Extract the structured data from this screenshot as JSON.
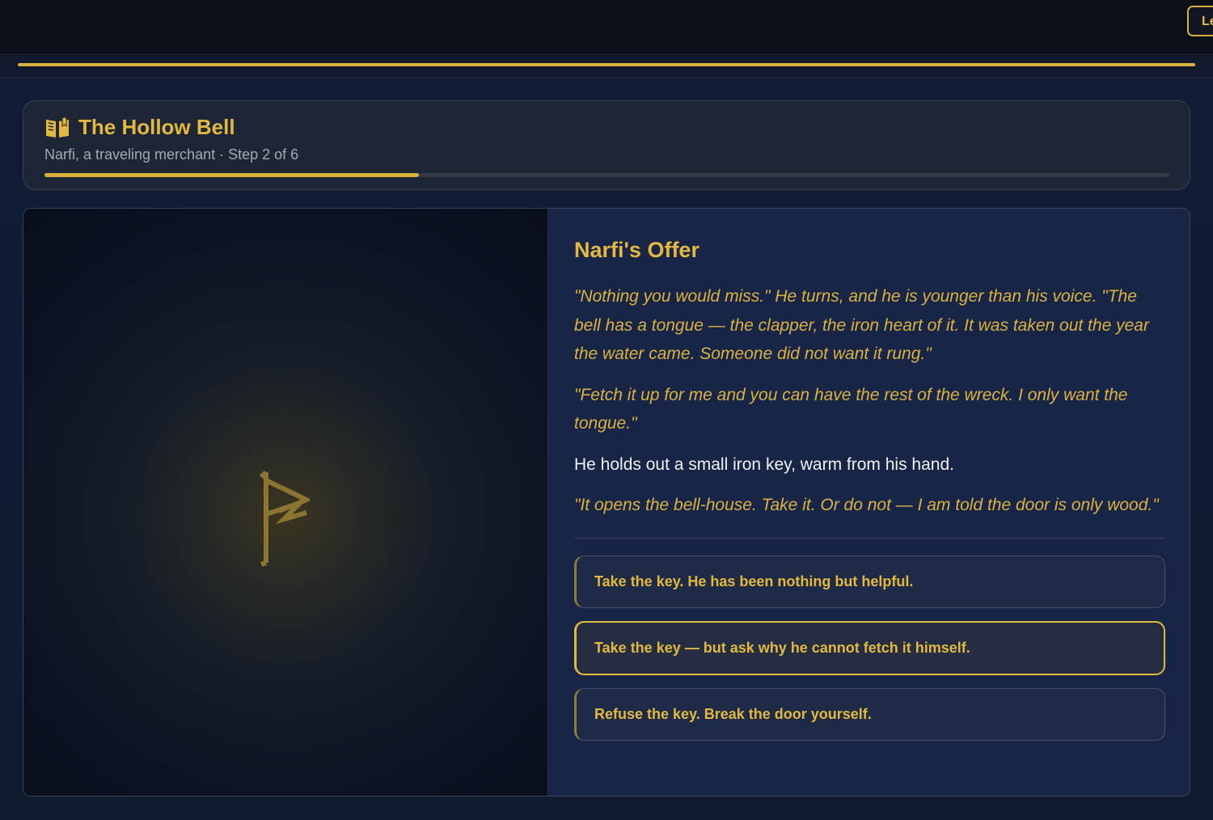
{
  "topbar": {
    "button_label": "Leave"
  },
  "story": {
    "title": "The Hollow Bell",
    "subtitle": "Narfi, a traveling merchant · Step 2 of 6",
    "step_current": 2,
    "step_total": 6,
    "progress_fraction": 0.333,
    "icon": "open-book-icon"
  },
  "scene": {
    "art_glyph": "ᚠ",
    "title": "Narfi's Offer",
    "paragraphs": [
      {
        "kind": "quote",
        "text": "\"Nothing you would miss.\" He turns, and he is younger than his voice. \"The bell has a tongue — the clapper, the iron heart of it. It was taken out the year the water came. Someone did not want it rung.\""
      },
      {
        "kind": "quote",
        "text": "\"Fetch it up for me and you can have the rest of the wreck. I only want the tongue.\""
      },
      {
        "kind": "narr",
        "text": "He holds out a small iron key, warm from his hand."
      },
      {
        "kind": "quote",
        "text": "\"It opens the bell-house. Take it. Or do not — I am told the door is only wood.\""
      }
    ],
    "choices": [
      {
        "label": "Take the key. He has been nothing but helpful.",
        "selected": false
      },
      {
        "label": "Take the key — but ask why he cannot fetch it himself.",
        "selected": true
      },
      {
        "label": "Refuse the key. Break the door yourself.",
        "selected": false
      }
    ]
  },
  "colors": {
    "accent": "#d8b13d",
    "background": "#0d1322",
    "panel": "#192546"
  }
}
